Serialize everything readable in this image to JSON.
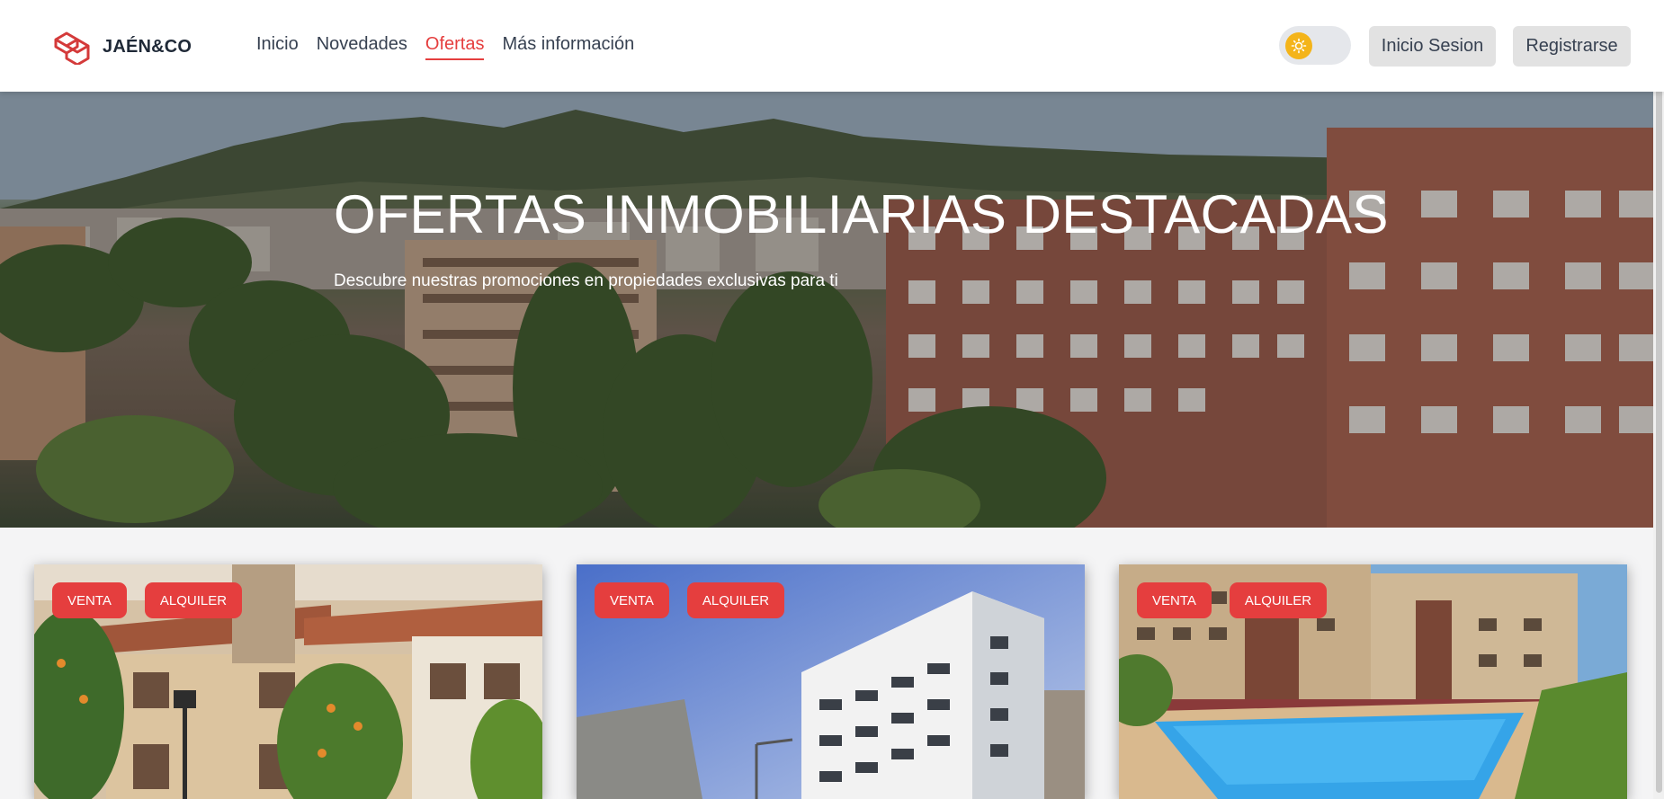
{
  "brand": {
    "name": "JAÉN&CO",
    "accent_color": "#e53e3e"
  },
  "nav": {
    "items": [
      {
        "label": "Inicio",
        "active": false
      },
      {
        "label": "Novedades",
        "active": false
      },
      {
        "label": "Ofertas",
        "active": true
      },
      {
        "label": "Más información",
        "active": false
      }
    ]
  },
  "header": {
    "theme_toggle": {
      "icon": "sun-icon",
      "state": "light"
    },
    "login_label": "Inicio Sesion",
    "register_label": "Registrarse"
  },
  "hero": {
    "title": "OFERTAS INMOBILIARIAS DESTACADAS",
    "subtitle": "Descubre nuestras promociones en propiedades exclusivas para ti"
  },
  "listings": [
    {
      "badges": [
        "VENTA",
        "ALQUILER"
      ]
    },
    {
      "badges": [
        "VENTA",
        "ALQUILER"
      ]
    },
    {
      "badges": [
        "VENTA",
        "ALQUILER"
      ]
    }
  ]
}
